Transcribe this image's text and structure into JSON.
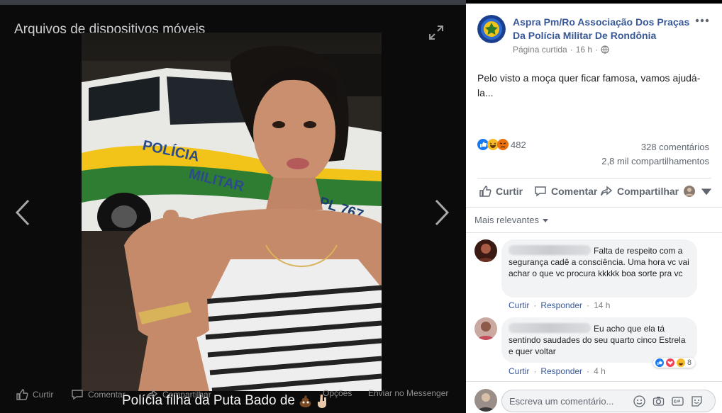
{
  "viewer": {
    "album_title": "Arquivos de dispositivos móveis",
    "actions": {
      "like": "Curtir",
      "comment": "Comentar",
      "share": "Compartilhar",
      "options": "Opções",
      "messenger": "Enviar no Messenger"
    },
    "caption": "Polícia filha da Puta Bado de",
    "photo": {
      "vehicle_text_1": "POLÍCIA",
      "vehicle_text_2": "MILITAR",
      "vehicle_plate": "CPL 767"
    }
  },
  "post": {
    "page_name": "Aspra Pm/Ro Associação Dos Praças Da Polícia Militar De Rondônia",
    "meta_label": "Página curtida",
    "meta_time": "16 h",
    "text": "Pelo visto a moça quer ficar famosa, vamos ajudá-la...",
    "reactions_count": "482",
    "comments_count": "328 comentários",
    "shares_count": "2,8 mil compartilhamentos",
    "actions": {
      "like": "Curtir",
      "comment": "Comentar",
      "share": "Compartilhar"
    },
    "sort_label": "Mais relevantes"
  },
  "comments": [
    {
      "text": "Falta de respeito com a segurança cadê a consciência. Uma hora vc vai achar o que vc procura kkkkk boa sorte pra vc",
      "like": "Curtir",
      "reply": "Responder",
      "time": "14 h"
    },
    {
      "text": "Eu acho que ela tá sentindo saudades do seu quarto cinco Estrela e quer voltar",
      "like": "Curtir",
      "reply": "Responder",
      "time": "4 h",
      "reactions_count": "8"
    }
  ],
  "composer": {
    "placeholder": "Escreva um comentário..."
  },
  "colors": {
    "link_blue": "#385898",
    "like_blue": "#1877f2",
    "haha_yellow": "#f7b928",
    "angry_orange": "#e9710f"
  }
}
